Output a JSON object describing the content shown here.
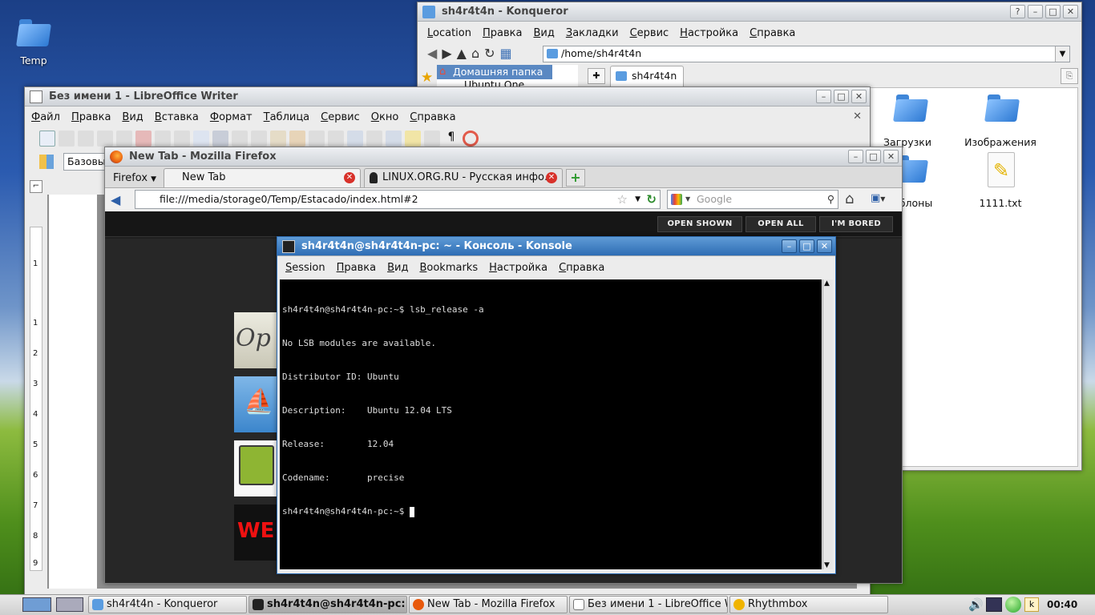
{
  "desktop": {
    "temp_icon_label": "Temp"
  },
  "konqueror": {
    "title": "sh4r4t4n - Konqueror",
    "menu": [
      "Location",
      "Правка",
      "Вид",
      "Закладки",
      "Сервис",
      "Настройка",
      "Справка"
    ],
    "address": "/home/sh4r4t4n",
    "sidebar_home": "Домашняя папка",
    "sidebar_next": "Ubuntu One",
    "tab": "sh4r4t4n",
    "files": [
      {
        "name": "Загрузки",
        "type": "folder"
      },
      {
        "name": "Изображения",
        "type": "folder"
      },
      {
        "name": "Шаблоны",
        "type": "folder"
      },
      {
        "name": "1111.txt",
        "type": "text"
      }
    ]
  },
  "writer": {
    "title": "Без имени 1 - LibreOffice Writer",
    "menu": [
      "Файл",
      "Правка",
      "Вид",
      "Вставка",
      "Формат",
      "Таблица",
      "Сервис",
      "Окно",
      "Справка"
    ],
    "style_box": "Базовый",
    "ruler": [
      "1",
      "1",
      "2",
      "3",
      "4",
      "5",
      "6",
      "7",
      "8",
      "9"
    ]
  },
  "firefox": {
    "title": "New Tab - Mozilla Firefox",
    "menu_button": "Firefox",
    "tabs": [
      "New Tab",
      "LINUX.ORG.RU - Русская инфо..."
    ],
    "url": "file:///media/storage0/Temp/Estacado/index.html#2",
    "search_placeholder": "Google",
    "page_buttons": [
      "OPEN SHOWN",
      "OPEN ALL",
      "I'M BORED"
    ],
    "tiles": [
      "Op",
      "WE"
    ]
  },
  "konsole": {
    "title": "sh4r4t4n@sh4r4t4n-pc: ~ - Консоль - Konsole",
    "menu": [
      "Session",
      "Правка",
      "Вид",
      "Bookmarks",
      "Настройка",
      "Справка"
    ],
    "lines": [
      "sh4r4t4n@sh4r4t4n-pc:~$ lsb_release -a",
      "No LSB modules are available.",
      "Distributor ID:\tUbuntu",
      "Description:\tUbuntu 12.04 LTS",
      "Release:\t12.04",
      "Codename:\tprecise",
      "sh4r4t4n@sh4r4t4n-pc:~$ "
    ]
  },
  "taskbar": {
    "items": [
      "sh4r4t4n - Konqueror",
      "sh4r4t4n@sh4r4t4n-pc: ~",
      "New Tab - Mozilla Firefox",
      "Без имени 1 - LibreOffice W",
      "Rhythmbox"
    ],
    "clock": "00:40"
  }
}
